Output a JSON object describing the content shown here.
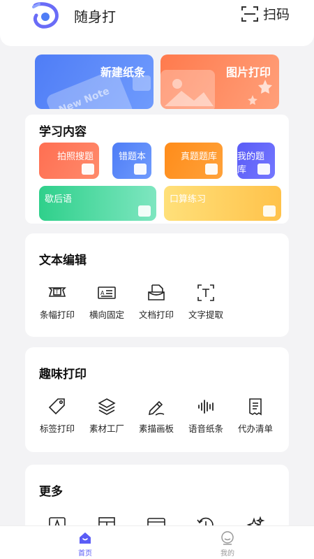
{
  "header": {
    "app_title": "随身打",
    "scan_label": "扫码"
  },
  "top_cards": {
    "new_note": "新建纸条",
    "photo_print": "图片打印",
    "note_deco_text": "New Note"
  },
  "study": {
    "title": "学习内容",
    "items": [
      {
        "label": "拍照搜题",
        "icon": "camera-icon"
      },
      {
        "label": "错题本",
        "icon": "close-box-icon"
      },
      {
        "label": "真题题库",
        "icon": "book-icon"
      },
      {
        "label": "我的题库",
        "icon": "document-icon"
      },
      {
        "label": "歇后语",
        "icon": "chat-icon"
      },
      {
        "label": "口算练习",
        "icon": "dice-icon"
      }
    ]
  },
  "text_edit": {
    "title": "文本编辑",
    "items": [
      {
        "label": "条幅打印",
        "icon": "banner-icon"
      },
      {
        "label": "横向固定",
        "icon": "horizontal-text-icon"
      },
      {
        "label": "文档打印",
        "icon": "document-print-icon"
      },
      {
        "label": "文字提取",
        "icon": "text-extract-icon"
      }
    ]
  },
  "fun_print": {
    "title": "趣味打印",
    "items": [
      {
        "label": "标签打印",
        "icon": "tag-icon"
      },
      {
        "label": "素材工厂",
        "icon": "layers-icon"
      },
      {
        "label": "素描画板",
        "icon": "pencil-icon"
      },
      {
        "label": "语音纸条",
        "icon": "voice-wave-icon"
      },
      {
        "label": "代办清单",
        "icon": "checklist-icon"
      }
    ]
  },
  "more": {
    "title": "更多",
    "items": [
      {
        "icon": "font-icon"
      },
      {
        "icon": "grid-text-icon"
      },
      {
        "icon": "browser-icon"
      },
      {
        "icon": "history-icon"
      },
      {
        "icon": "sparkle-icon"
      }
    ]
  },
  "bottom_nav": {
    "home": "首页",
    "me": "我的"
  },
  "colors": {
    "accent": "#5a5cf6",
    "blue": "#4f7df6",
    "orange": "#ff7a4d"
  }
}
